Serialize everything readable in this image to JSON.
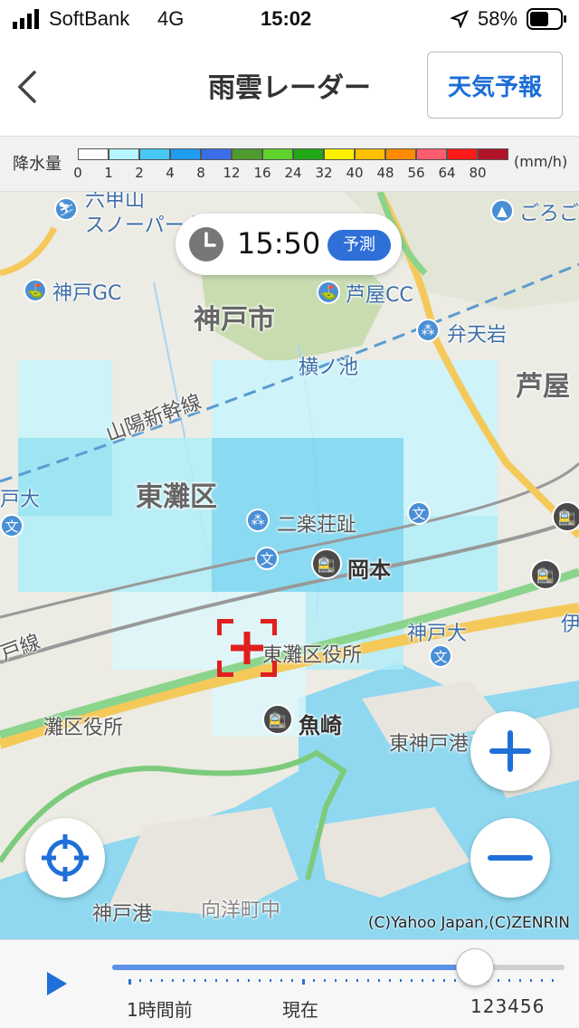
{
  "status_bar": {
    "carrier": "SoftBank",
    "network": "4G",
    "time": "15:02",
    "battery": "58%"
  },
  "header": {
    "title": "雨雲レーダー",
    "forecast_button": "天気予報"
  },
  "legend": {
    "label": "降水量",
    "unit": "(mm/h)",
    "ticks": [
      "0",
      "1",
      "2",
      "4",
      "8",
      "12",
      "16",
      "24",
      "32",
      "40",
      "48",
      "56",
      "64",
      "80"
    ],
    "colors": [
      "#ffffff",
      "#b6f5ff",
      "#48c8f5",
      "#1f9bf0",
      "#3a6ee8",
      "#4e9a2e",
      "#5fd22b",
      "#22a817",
      "#fff000",
      "#ffc000",
      "#ff8a00",
      "#ff5c6e",
      "#ff1a1a",
      "#b0142a"
    ]
  },
  "time_pill": {
    "time": "15:50",
    "badge": "予測"
  },
  "map_labels": {
    "rokko_ski": "六甲山\nスノーパーク",
    "kobe_gc": "神戸GC",
    "ashiya_cc": "芦屋CC",
    "kobe_city": "神戸市",
    "bentenwa": "弁天岩",
    "yokoike": "横ノ池",
    "ashiya": "芦屋",
    "sanyo_shinkansen": "山陽新幹線",
    "higashinada_ku": "東灘区",
    "nirakusou": "二楽荘趾",
    "okamoto": "岡本",
    "kobe_dai_left": "戸大",
    "kobe_dai": "神戸大",
    "higashinada_office": "東灘区役所",
    "nada_office": "灘区役所",
    "uozaki": "魚崎",
    "higashikobe_port": "東神戸港",
    "kobe_port": "神戸港",
    "koyocho": "向洋町中",
    "goroku": "ごろご",
    "line_left": "戸線",
    "i_right": "伊"
  },
  "copyright": "(C)Yahoo Japan,(C)ZENRIN",
  "timeline": {
    "label_before": "1時間前",
    "label_now": "現在",
    "label_future": "123456",
    "progress": 0.8
  }
}
